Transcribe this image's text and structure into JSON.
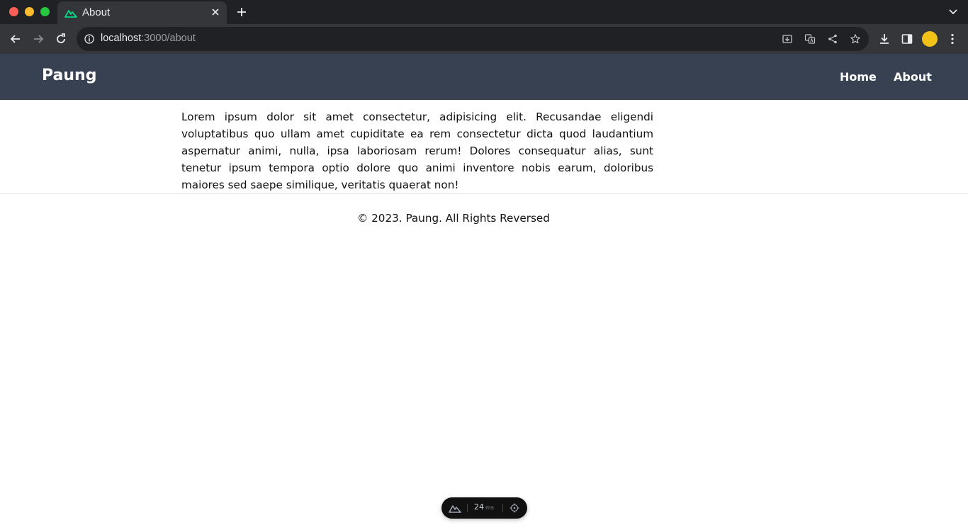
{
  "browser": {
    "tab": {
      "title": "About",
      "favicon": "nuxt-icon"
    },
    "address": {
      "host": "localhost",
      "path": ":3000/about"
    }
  },
  "site": {
    "brand": "Paung",
    "nav": [
      {
        "label": "Home"
      },
      {
        "label": "About"
      }
    ],
    "header_color": "#374151"
  },
  "content": {
    "paragraph": "Lorem ipsum dolor sit amet consectetur, adipisicing elit. Recusandae eligendi voluptatibus quo ullam amet cupiditate ea rem consectetur dicta quod laudantium aspernatur animi, nulla, ipsa laboriosam rerum! Dolores consequatur alias, sunt tenetur ipsum tempora optio dolore quo animi inventore nobis earum, doloribus maiores sed saepe similique, veritatis quaerat non!"
  },
  "footer": {
    "text": "© 2023. Paung. All Rights Reversed"
  },
  "devtools": {
    "time": "24",
    "unit": "ms"
  }
}
